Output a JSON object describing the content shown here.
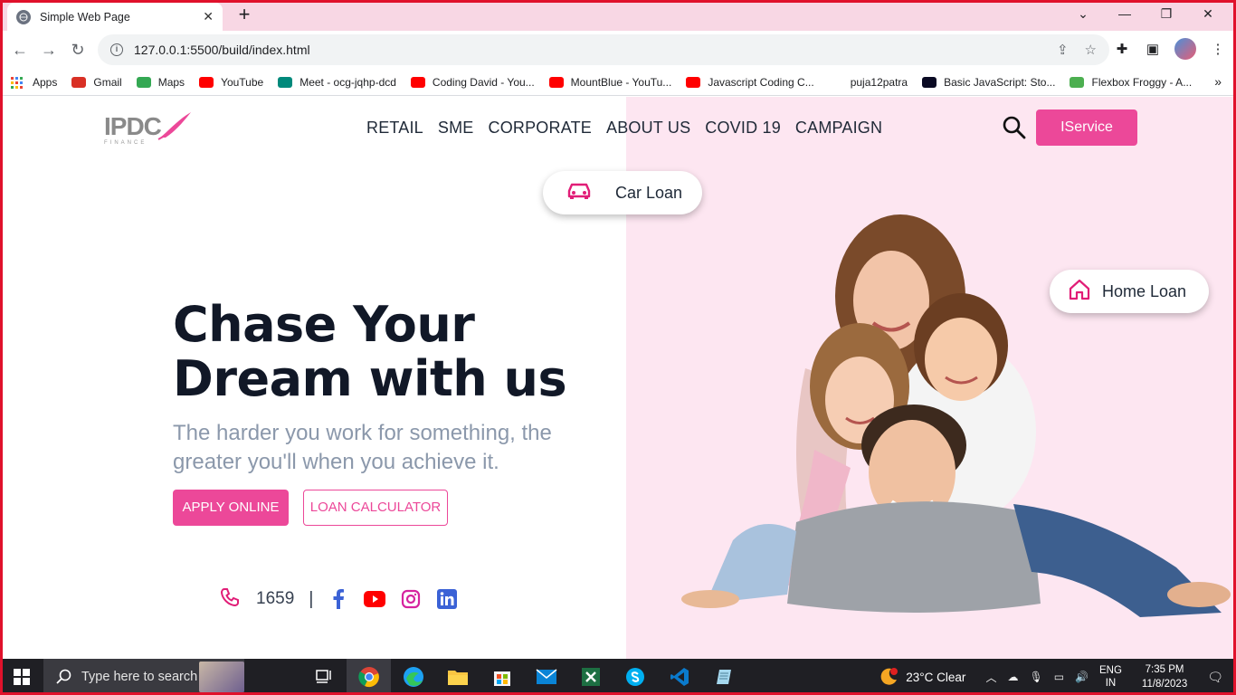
{
  "browser": {
    "tab_title": "Simple Web Page",
    "url": "127.0.0.1:5500/build/index.html",
    "bookmarks": [
      {
        "label": "Apps",
        "color": "#ea4335"
      },
      {
        "label": "Gmail",
        "color": "#d93025"
      },
      {
        "label": "Maps",
        "color": "#34a853"
      },
      {
        "label": "YouTube",
        "color": "#ff0000"
      },
      {
        "label": "Meet - ocg-jqhp-dcd",
        "color": "#00897b"
      },
      {
        "label": "Coding David - You...",
        "color": "#ff0000"
      },
      {
        "label": "MountBlue - YouTu...",
        "color": "#ff0000"
      },
      {
        "label": "Javascript Coding C...",
        "color": "#ff0000"
      },
      {
        "label": "puja12patra",
        "color": "#ffffff"
      },
      {
        "label": "Basic JavaScript: Sto...",
        "color": "#0a0a23"
      },
      {
        "label": "Flexbox Froggy - A...",
        "color": "#4caf50"
      }
    ]
  },
  "site": {
    "logo_text": "IPDC",
    "logo_sub": "FINANCE",
    "nav": [
      "RETAIL",
      "SME",
      "CORPORATE",
      "ABOUT US",
      "COVID 19",
      "CAMPAIGN"
    ],
    "cta": "IService",
    "car_pill": "Car Loan",
    "home_pill": "Home Loan",
    "headline_1": "Chase Your",
    "headline_2": "Dream with us",
    "subline": "The harder you work for something, the greater you'll when you achieve it.",
    "apply": "APPLY ONLINE",
    "calculator": "LOAN CALCULATOR",
    "phone": "1659",
    "separator": "|",
    "accent": "#ec4899"
  },
  "taskbar": {
    "search_placeholder": "Type here to search",
    "weather": "23°C  Clear",
    "lang_1": "ENG",
    "lang_2": "IN",
    "time": "7:35 PM",
    "date": "11/8/2023"
  }
}
